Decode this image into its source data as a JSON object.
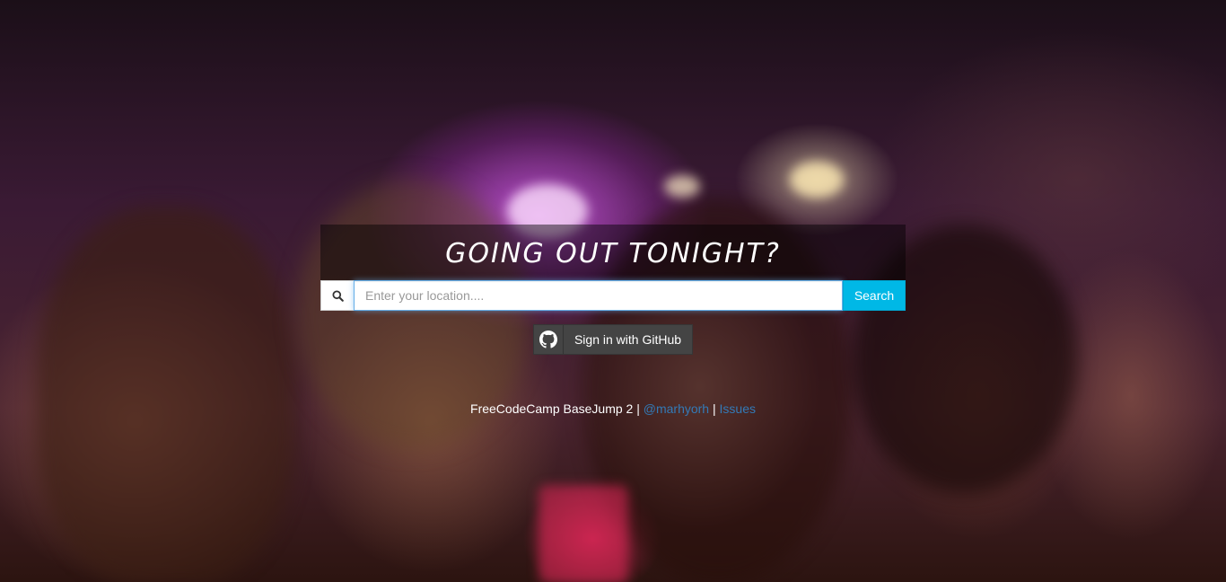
{
  "hero": {
    "title": "Going out tonight?"
  },
  "search": {
    "icon": "search-icon",
    "placeholder": "Enter your location....",
    "value": "",
    "button_label": "Search"
  },
  "auth": {
    "icon": "github-icon",
    "github_label": "Sign in with GitHub"
  },
  "footer": {
    "text": "FreeCodeCamp BaseJump 2",
    "sep1": "|",
    "author_link": "@marhyorh",
    "sep2": "|",
    "issues_link": "Issues"
  },
  "colors": {
    "search_button": "#00b8e6",
    "github_button": "#444444",
    "link": "#337ab7"
  }
}
